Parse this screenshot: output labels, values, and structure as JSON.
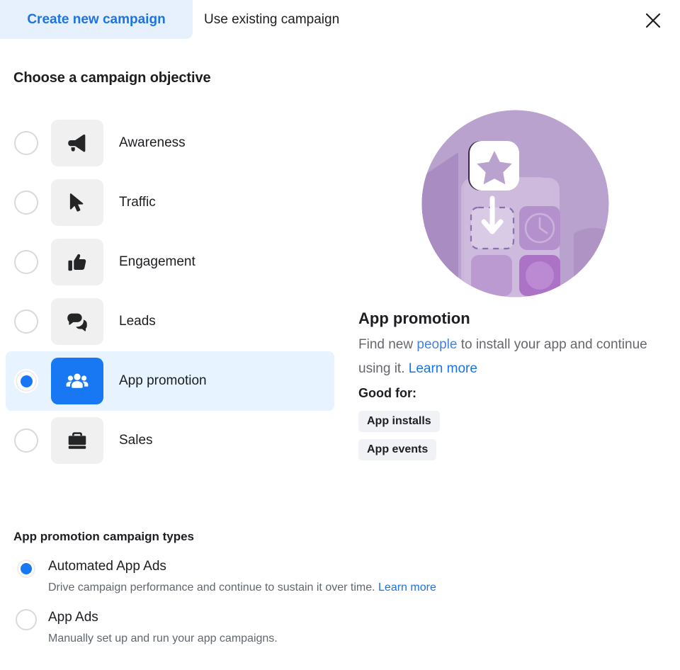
{
  "tabs": [
    {
      "label": "Create new campaign",
      "active": true
    },
    {
      "label": "Use existing campaign",
      "active": false
    }
  ],
  "close_icon": "close-icon",
  "objective_section": {
    "heading": "Choose a campaign objective",
    "items": [
      {
        "label": "Awareness",
        "icon": "megaphone-icon",
        "selected": false
      },
      {
        "label": "Traffic",
        "icon": "cursor-icon",
        "selected": false
      },
      {
        "label": "Engagement",
        "icon": "thumbs-up-icon",
        "selected": false
      },
      {
        "label": "Leads",
        "icon": "chat-bubbles-icon",
        "selected": false
      },
      {
        "label": "App promotion",
        "icon": "people-group-icon",
        "selected": true
      },
      {
        "label": "Sales",
        "icon": "briefcase-icon",
        "selected": false
      }
    ]
  },
  "detail": {
    "illustration": "app-promotion-illustration",
    "title": "App promotion",
    "description_parts": [
      {
        "text": "Find new ",
        "style": "plain"
      },
      {
        "text": "people",
        "style": "link-soft"
      },
      {
        "text": " to install your app and continue using it. ",
        "style": "plain"
      },
      {
        "text": "Learn more",
        "style": "link"
      }
    ],
    "good_for_label": "Good for:",
    "chips": [
      "App installs",
      "App events"
    ]
  },
  "campaign_types": {
    "heading": "App promotion campaign types",
    "options": [
      {
        "title": "Automated App Ads",
        "subtitle": "Drive campaign performance and continue to sustain it over time.",
        "link": "Learn more",
        "selected": true
      },
      {
        "title": "App Ads",
        "subtitle": "Manually set up and run your app campaigns.",
        "link": "",
        "selected": false
      }
    ]
  },
  "colors": {
    "accent_blue": "#1877f2",
    "link_blue": "#1b74e4",
    "tab_active_bg": "#e7f0fd",
    "row_selected_bg": "#e7f3ff",
    "tile_bg": "#f0f0f0",
    "chip_bg": "#f0f2f5",
    "text_primary": "#1c1e21",
    "text_secondary": "#65676b",
    "illustration_purple": "#b49ac9"
  }
}
